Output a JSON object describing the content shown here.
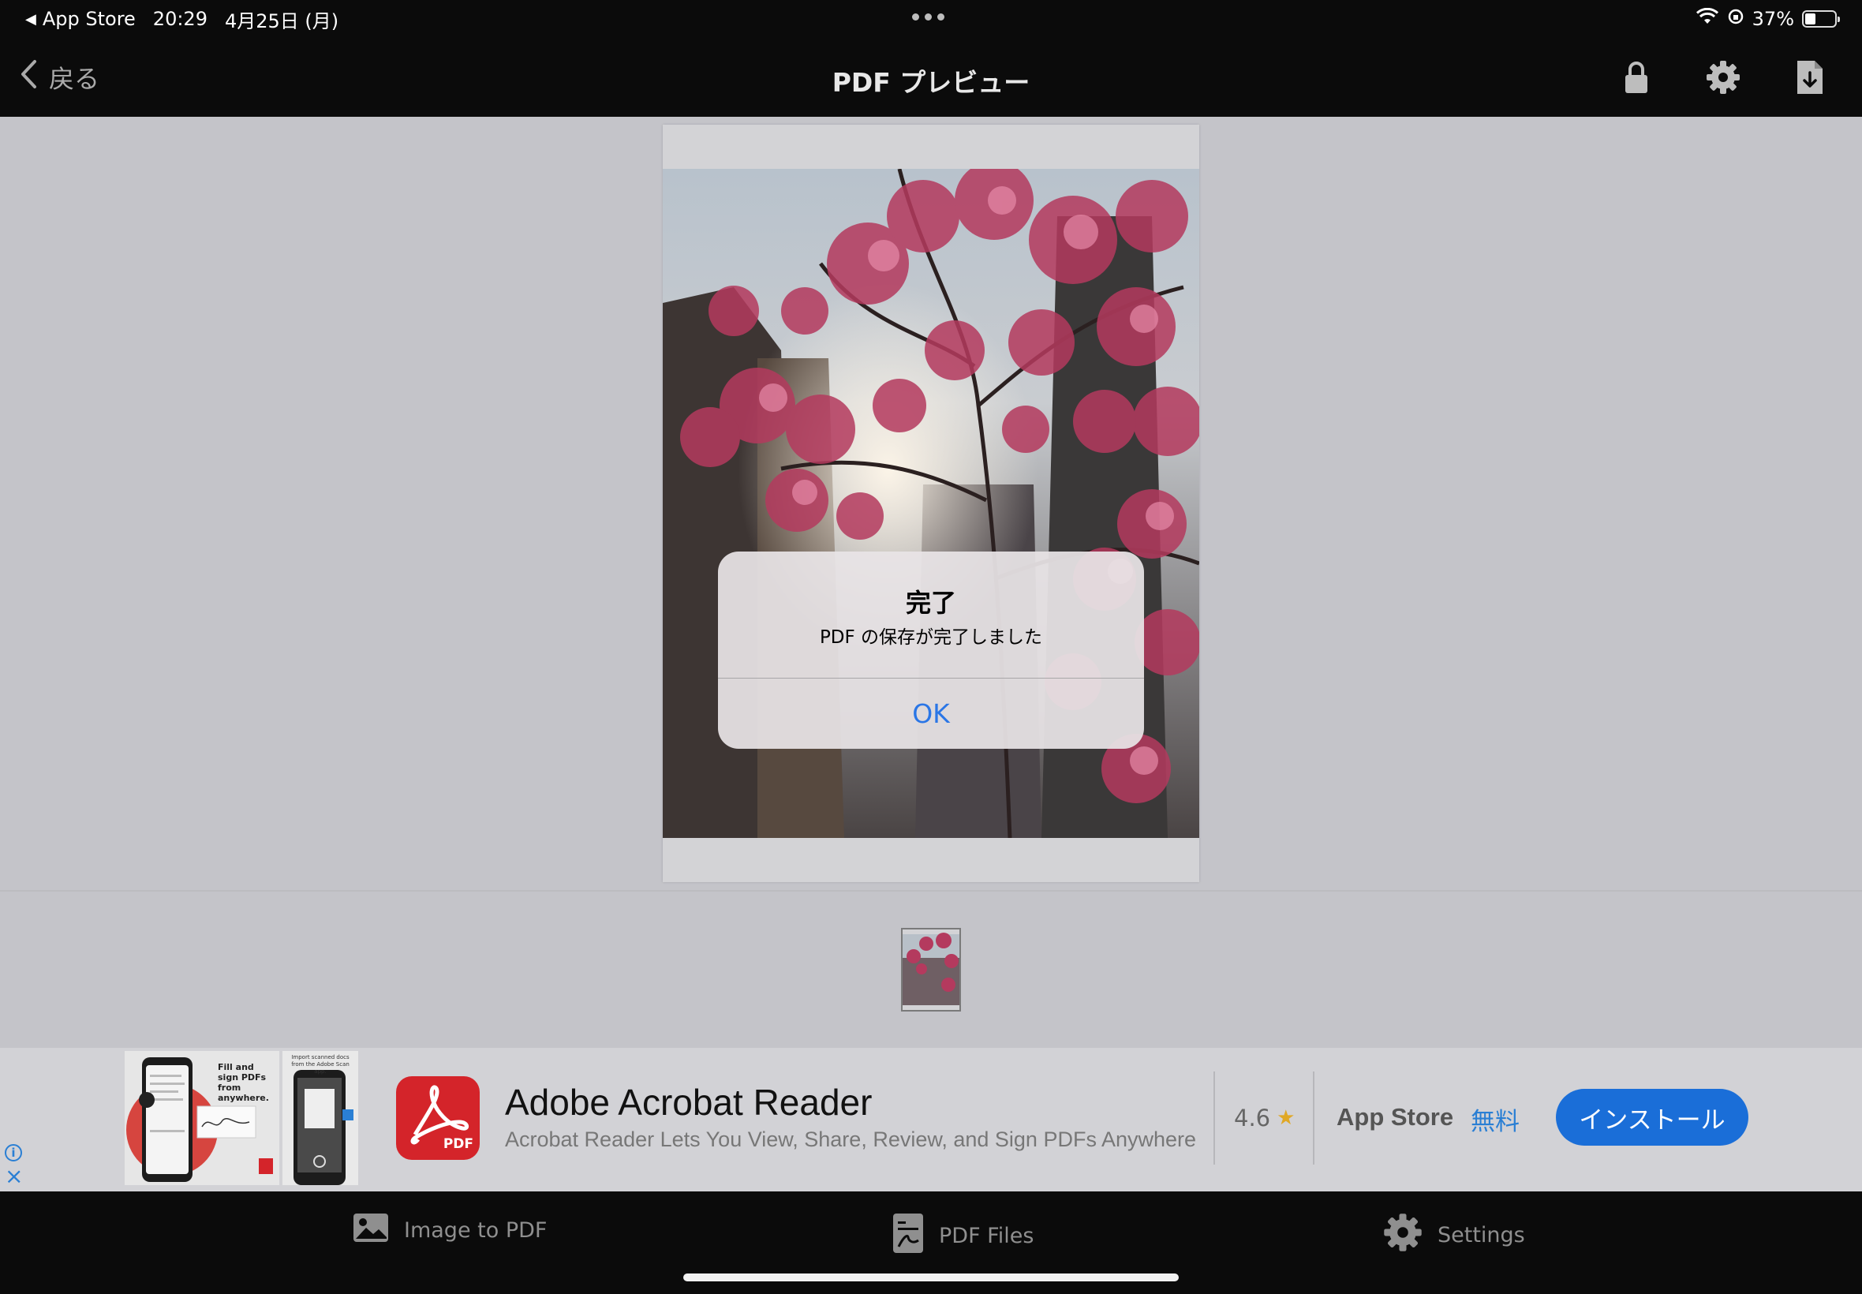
{
  "status_bar": {
    "back_app": "App Store",
    "time": "20:29",
    "date": "4月25日 (月)",
    "battery_percent": "37%",
    "battery_level": 0.37
  },
  "nav": {
    "back_label": "戻る",
    "title": "PDF プレビュー",
    "icons": [
      "lock-icon",
      "gear-icon",
      "file-download-icon"
    ]
  },
  "alert": {
    "title": "完了",
    "message": "PDF の保存が完了しました",
    "ok_label": "OK",
    "ok_color": "#2a76e6"
  },
  "ad": {
    "app_name": "Adobe Acrobat Reader",
    "subtitle": "Acrobat Reader Lets You View, Share, Review, and Sign PDFs Anywhere",
    "rating": "4.6",
    "store": "App Store",
    "price": "無料",
    "install_label": "インストール",
    "logo_label": "PDF",
    "screenshot1_text": "Fill and sign PDFs from anywhere.",
    "screenshot2_text": "Import scanned docs from the Adobe Scan app.",
    "accent": "#1a6ed8"
  },
  "tabs": [
    {
      "label": "Image to PDF",
      "icon": "image-icon"
    },
    {
      "label": "PDF Files",
      "icon": "pdf-files-icon"
    },
    {
      "label": "Settings",
      "icon": "gear-icon"
    }
  ]
}
